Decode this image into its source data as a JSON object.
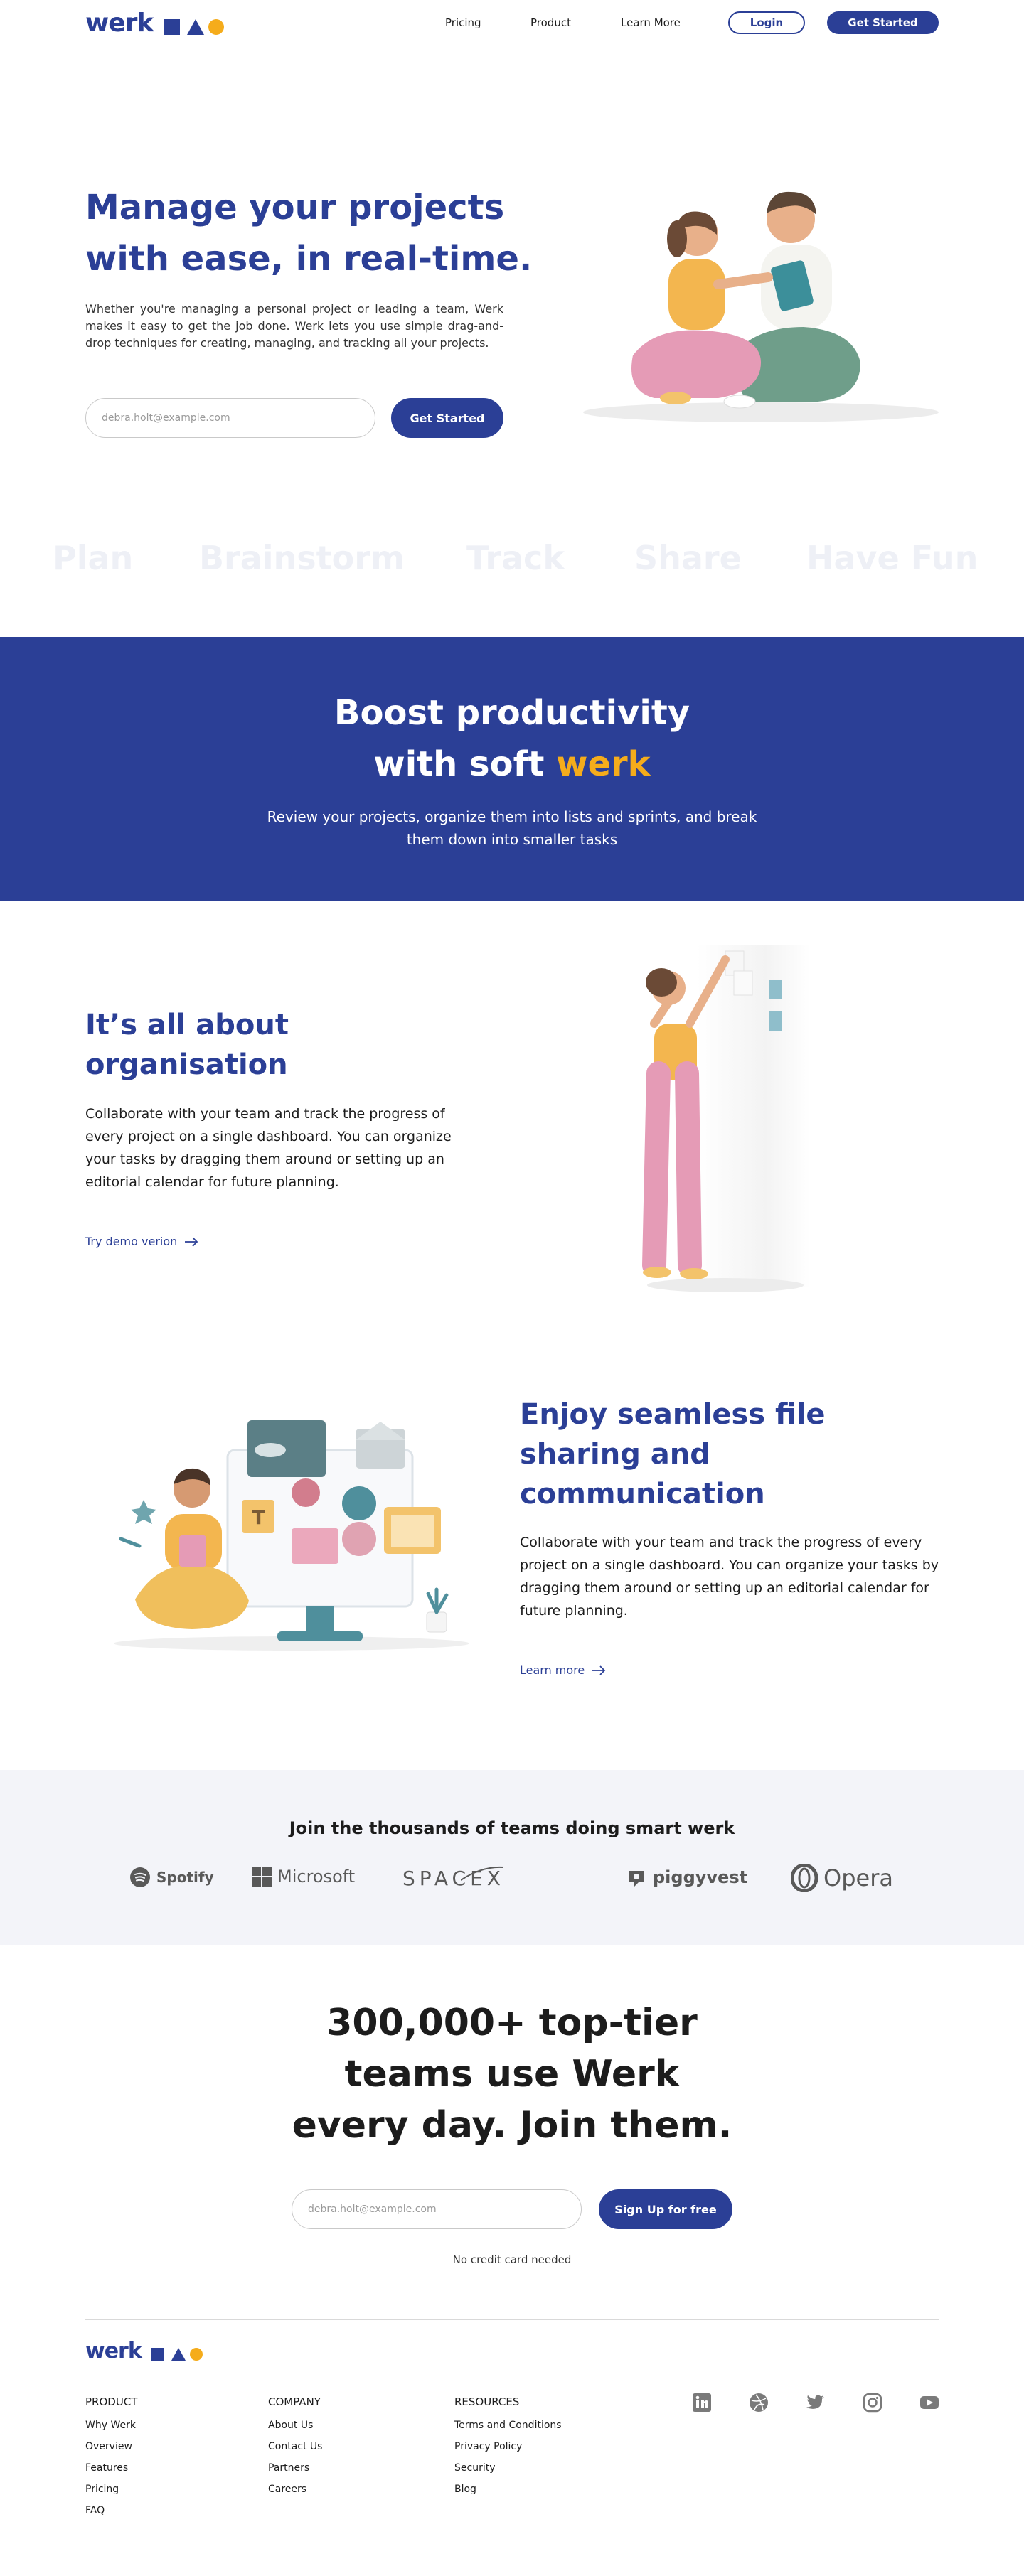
{
  "nav": {
    "logo_text": "werk",
    "links": [
      "Pricing",
      "Product",
      "Learn More"
    ],
    "login_label": "Login",
    "get_started_label": "Get Started"
  },
  "hero": {
    "title_line1": "Manage your projects",
    "title_line2": "with ease, in real-time.",
    "description": "Whether you're managing a personal project or leading a team, Werk makes it easy to get the job done. Werk lets you use simple drag-and-drop techniques for creating, managing, and tracking all your projects.",
    "email_placeholder": "debra.holt@example.com",
    "cta_label": "Get Started"
  },
  "ghost_words": [
    "Plan",
    "Brainstorm",
    "Track",
    "Share",
    "Have Fun"
  ],
  "band": {
    "title_line1": "Boost productivity",
    "title_line2_prefix": "with soft ",
    "title_line2_accent": "werk",
    "subtitle_line1": "Review your projects, organize them into lists and sprints, and break",
    "subtitle_line2": "them down into smaller tasks"
  },
  "feature1": {
    "title_line1": "It’s all about",
    "title_line2": "organisation",
    "body": "Collaborate with your team and track the progress of every project on a single dashboard. You can organize your tasks by dragging them around or setting up an editorial calendar for future planning.",
    "link_label": "Try demo verion"
  },
  "feature2": {
    "title_line1": "Enjoy seamless file",
    "title_line2": "sharing and",
    "title_line3": "communication",
    "body": "Collaborate with your team and track the progress of every project on a single dashboard. You can organize your tasks by dragging them around or setting up an editorial calendar for future planning.",
    "link_label": "Learn more"
  },
  "logos": {
    "title": "Join the thousands of teams doing smart werk",
    "brands": [
      "Spotify",
      "Microsoft",
      "SPACEX",
      "piggyvest",
      "Opera"
    ]
  },
  "signup": {
    "title_line1": "300,000+ top-tier",
    "title_line2": "teams use Werk",
    "title_line3": "every day. Join them.",
    "email_placeholder": "debra.holt@example.com",
    "cta_label": "Sign Up for free",
    "note": "No credit card needed"
  },
  "footer": {
    "logo_text": "werk",
    "product_heading": "PRODUCT",
    "product_links": [
      "Why Werk",
      "Overview",
      "Features",
      "Pricing",
      "FAQ"
    ],
    "company_heading": "COMPANY",
    "company_links": [
      "About Us",
      "Contact Us",
      "Partners",
      "Careers"
    ],
    "resources_heading": "RESOURCES",
    "resources_links": [
      "Terms and Conditions",
      "Privacy Policy",
      "Security",
      "Blog"
    ],
    "social_icons": [
      "linkedin-icon",
      "dribbble-icon",
      "twitter-icon",
      "instagram-icon",
      "youtube-icon"
    ]
  },
  "colors": {
    "brand_blue": "#2b3f96",
    "accent_yellow": "#f5ac1b",
    "light_band": "#f3f4f9"
  }
}
